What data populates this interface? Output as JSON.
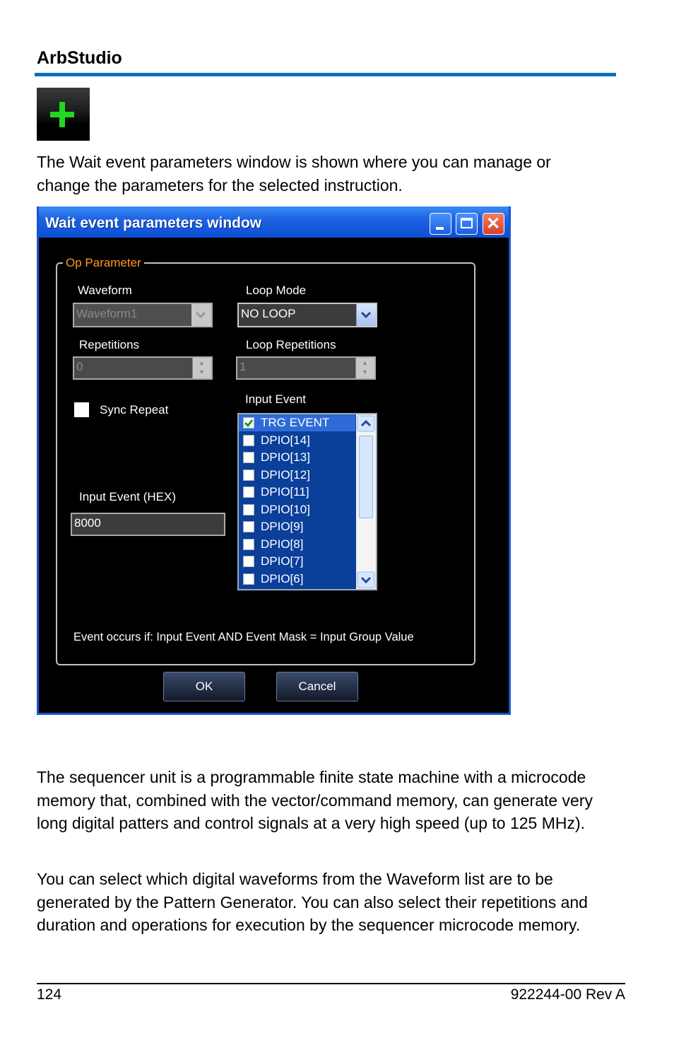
{
  "header": {
    "title": "ArbStudio"
  },
  "icon": {
    "name": "add-plus-icon",
    "color": "#22d81f"
  },
  "intro_text": "The Wait event parameters window is shown where you can manage or change the parameters for the selected instruction.",
  "dialog": {
    "title": "Wait event parameters window",
    "group_label": "Op Parameter",
    "waveform": {
      "label": "Waveform",
      "value": "Waveform1"
    },
    "loop_mode": {
      "label": "Loop Mode",
      "value": "NO LOOP"
    },
    "repetitions": {
      "label": "Repetitions",
      "value": "0"
    },
    "loop_repetitions": {
      "label": "Loop Repetitions",
      "value": "1"
    },
    "sync_repeat": {
      "label": "Sync Repeat",
      "checked": false
    },
    "input_event_label": "Input Event",
    "input_events": [
      {
        "label": "TRG EVENT",
        "checked": true
      },
      {
        "label": "DPIO[14]",
        "checked": false
      },
      {
        "label": "DPIO[13]",
        "checked": false
      },
      {
        "label": "DPIO[12]",
        "checked": false
      },
      {
        "label": "DPIO[11]",
        "checked": false
      },
      {
        "label": "DPIO[10]",
        "checked": false
      },
      {
        "label": "DPIO[9]",
        "checked": false
      },
      {
        "label": "DPIO[8]",
        "checked": false
      },
      {
        "label": "DPIO[7]",
        "checked": false
      },
      {
        "label": "DPIO[6]",
        "checked": false
      }
    ],
    "input_event_hex": {
      "label": "Input Event (HEX)",
      "value": "8000"
    },
    "condition_text": "Event occurs if:  Input Event  AND Event Mask = Input Group Value",
    "ok_label": "OK",
    "cancel_label": "Cancel",
    "accent_color": "#1e63e3",
    "legend_color": "#ff9a20"
  },
  "body_paragraphs": [
    "The sequencer unit is a programmable finite state machine with a microcode memory that, combined with the vector/command memory, can generate very long digital patters and control signals at a very high speed (up to 125 MHz).",
    "You can select which digital waveforms from the Waveform list are to be generated by the Pattern Generator. You can also select their repetitions and duration and operations for execution by the sequencer microcode memory."
  ],
  "footer": {
    "page_number": "124",
    "doc_revision": "922244-00 Rev A"
  }
}
